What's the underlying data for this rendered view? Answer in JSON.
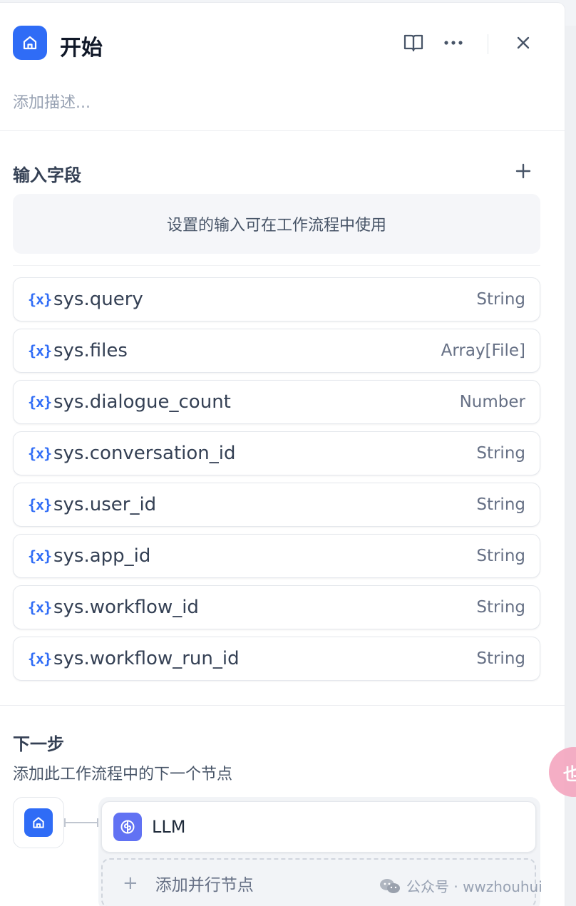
{
  "header": {
    "title": "开始",
    "description_placeholder": "添加描述..."
  },
  "input_fields": {
    "title": "输入字段",
    "hint": "设置的输入可在工作流程中使用",
    "variables": [
      {
        "icon": "{x}",
        "name": "sys.query",
        "type": "String"
      },
      {
        "icon": "{x}",
        "name": "sys.files",
        "type": "Array[File]"
      },
      {
        "icon": "{x}",
        "name": "sys.dialogue_count",
        "type": "Number"
      },
      {
        "icon": "{x}",
        "name": "sys.conversation_id",
        "type": "String"
      },
      {
        "icon": "{x}",
        "name": "sys.user_id",
        "type": "String"
      },
      {
        "icon": "{x}",
        "name": "sys.app_id",
        "type": "String"
      },
      {
        "icon": "{x}",
        "name": "sys.workflow_id",
        "type": "String"
      },
      {
        "icon": "{x}",
        "name": "sys.workflow_run_id",
        "type": "String"
      }
    ]
  },
  "next_step": {
    "title": "下一步",
    "description": "添加此工作流程中的下一个节点",
    "next_node_label": "LLM",
    "add_parallel_label": "添加并行节点"
  },
  "watermark": {
    "text": "公众号 · wwzhouhui"
  },
  "floating_bubble": {
    "text": "也"
  },
  "colors": {
    "accent": "#2f6cf6",
    "llm_icon_bg": "#6172f3"
  }
}
